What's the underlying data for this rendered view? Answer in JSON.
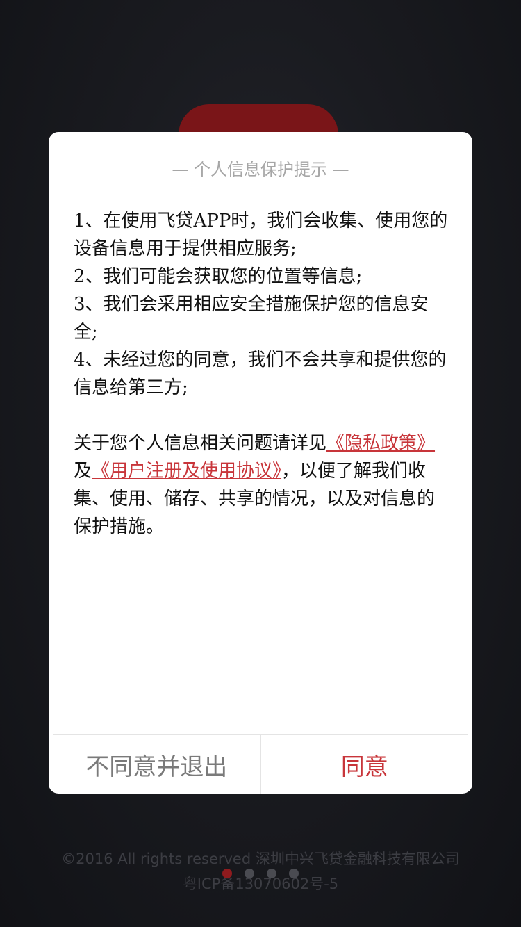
{
  "dialog": {
    "title": "— 个人信息保护提示 —",
    "items": [
      "1、在使用飞贷APP时，我们会收集、使用您的设备信息用于提供相应服务;",
      "2、我们可能会获取您的位置等信息;",
      "3、我们会采用相应安全措施保护您的信息安全;",
      "4、未经过您的同意，我们不会共享和提供您的信息给第三方;"
    ],
    "note": {
      "prefix": "关于您个人信息相关问题请详见",
      "privacy_link": "《隐私政策》",
      "connector": "及",
      "agreement_link": "《用户注册及使用协议》",
      "suffix": "，以便了解我们收集、使用、储存、共享的情况，以及对信息的保护措施。"
    },
    "buttons": {
      "disagree": "不同意并退出",
      "agree": "同意"
    }
  },
  "footer": {
    "copyright": "©2016 All rights reserved 深圳中兴飞贷金融科技有限公司",
    "icp": "粤ICP备13070602号-5"
  },
  "colors": {
    "accent": "#c8353a",
    "background": "#141418"
  }
}
